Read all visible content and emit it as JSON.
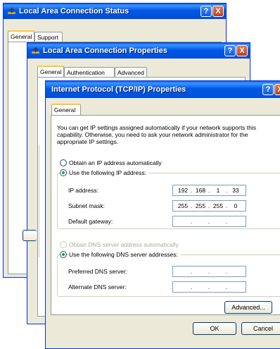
{
  "window1": {
    "title": "Local Area Connection Status",
    "help_label": "?",
    "close_label": "X",
    "tabs": [
      {
        "label": "General"
      },
      {
        "label": "Support"
      }
    ]
  },
  "window2": {
    "title": "Local Area Connection Properties",
    "help_label": "?",
    "close_label": "X",
    "tabs": [
      {
        "label": "General"
      },
      {
        "label": "Authentication"
      },
      {
        "label": "Advanced"
      }
    ]
  },
  "window3": {
    "title": "Internet Protocol (TCP/IP) Properties",
    "help_label": "?",
    "close_label": "X",
    "tabs": [
      {
        "label": "General"
      }
    ],
    "description": "You can get IP settings assigned automatically if your network supports this capability. Otherwise, you need to ask your network administrator for the appropriate IP settings.",
    "ip_mode": {
      "auto_label": "Obtain an IP address automatically",
      "manual_label": "Use the following IP address:",
      "selected": "manual"
    },
    "fields": {
      "ip_address": {
        "label": "IP address:",
        "octets": [
          "192",
          "168",
          "1",
          "33"
        ]
      },
      "subnet_mask": {
        "label": "Subnet mask:",
        "octets": [
          "255",
          "255",
          "255",
          "0"
        ]
      },
      "default_gateway": {
        "label": "Default gateway:",
        "octets": [
          "",
          "",
          "",
          ""
        ]
      }
    },
    "dns_mode": {
      "auto_label": "Obtain DNS server address automatically",
      "manual_label": "Use the following DNS server addresses:",
      "selected": "manual"
    },
    "dns_fields": {
      "preferred": {
        "label": "Preferred DNS server:",
        "octets": [
          "",
          "",
          "",
          ""
        ]
      },
      "alternate": {
        "label": "Alternate DNS server:",
        "octets": [
          "",
          "",
          "",
          ""
        ]
      }
    },
    "advanced_label": "Advanced...",
    "ok_label": "OK",
    "cancel_label": "Cancel",
    "octet_separator": "."
  },
  "colors": {
    "title_blue": "#0054e3",
    "close_red": "#c23c16",
    "dialog_bg": "#ece9d8",
    "radio_green": "#21a121"
  }
}
